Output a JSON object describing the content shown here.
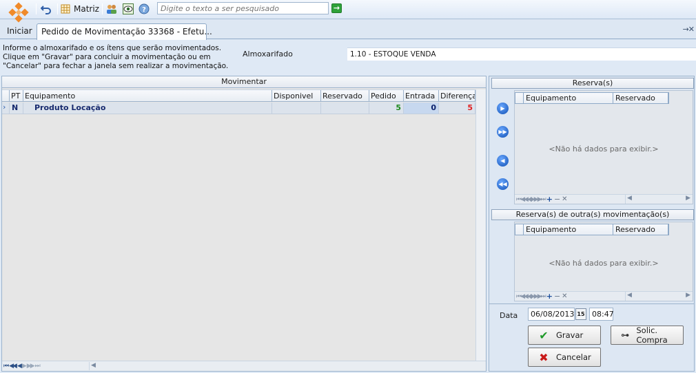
{
  "toolbar": {
    "matriz_label": "Matriz",
    "search_placeholder": "Digite o texto a ser pesquisado"
  },
  "tabs": {
    "home_label": "Iniciar",
    "active_label": "Pedido de Movimentação 33368 - Efetu..."
  },
  "info": {
    "instructions": "Informe o almoxarifado e os ítens que serão movimentados. Clique em \"Gravar\" para concluir a movimentação ou em \"Cancelar\" para fechar a janela sem realizar a movimentação.",
    "almox_label": "Almoxarifado",
    "almox_value": "1.10 - ESTOQUE VENDA"
  },
  "main_grid": {
    "title": "Movimentar",
    "columns": [
      "PT",
      "Equipamento",
      "Disponivel",
      "Reservado",
      "Pedido",
      "Entrada",
      "Diferença"
    ],
    "rows": [
      {
        "pt": "N",
        "equipamento": "Produto Locação",
        "disponivel": "",
        "reservado": "",
        "pedido": "5",
        "entrada": "0",
        "diferenca": "5"
      }
    ]
  },
  "reservas": {
    "title": "Reserva(s)",
    "columns": [
      "Equipamento",
      "Reservado"
    ],
    "empty_text": "<Não há dados para exibir.>"
  },
  "outras_reservas": {
    "title": "Reserva(s) de outra(s) movimentação(s)",
    "columns": [
      "Equipamento",
      "Reservado"
    ],
    "empty_text": "<Não há dados para exibir.>"
  },
  "footer_form": {
    "data_label": "Data",
    "date_value": "06/08/2013",
    "date_picker_glyph": "15",
    "time_value": "08:47"
  },
  "buttons": {
    "gravar": "Gravar",
    "cancelar": "Cancelar",
    "solic_compra": "Solic. Compra"
  },
  "colors": {
    "pedido_green": "#1f8a1f",
    "entrada_navy": "#0a1f6b",
    "diferenca_red": "#e02020",
    "row_text_navy": "#172a6e"
  }
}
